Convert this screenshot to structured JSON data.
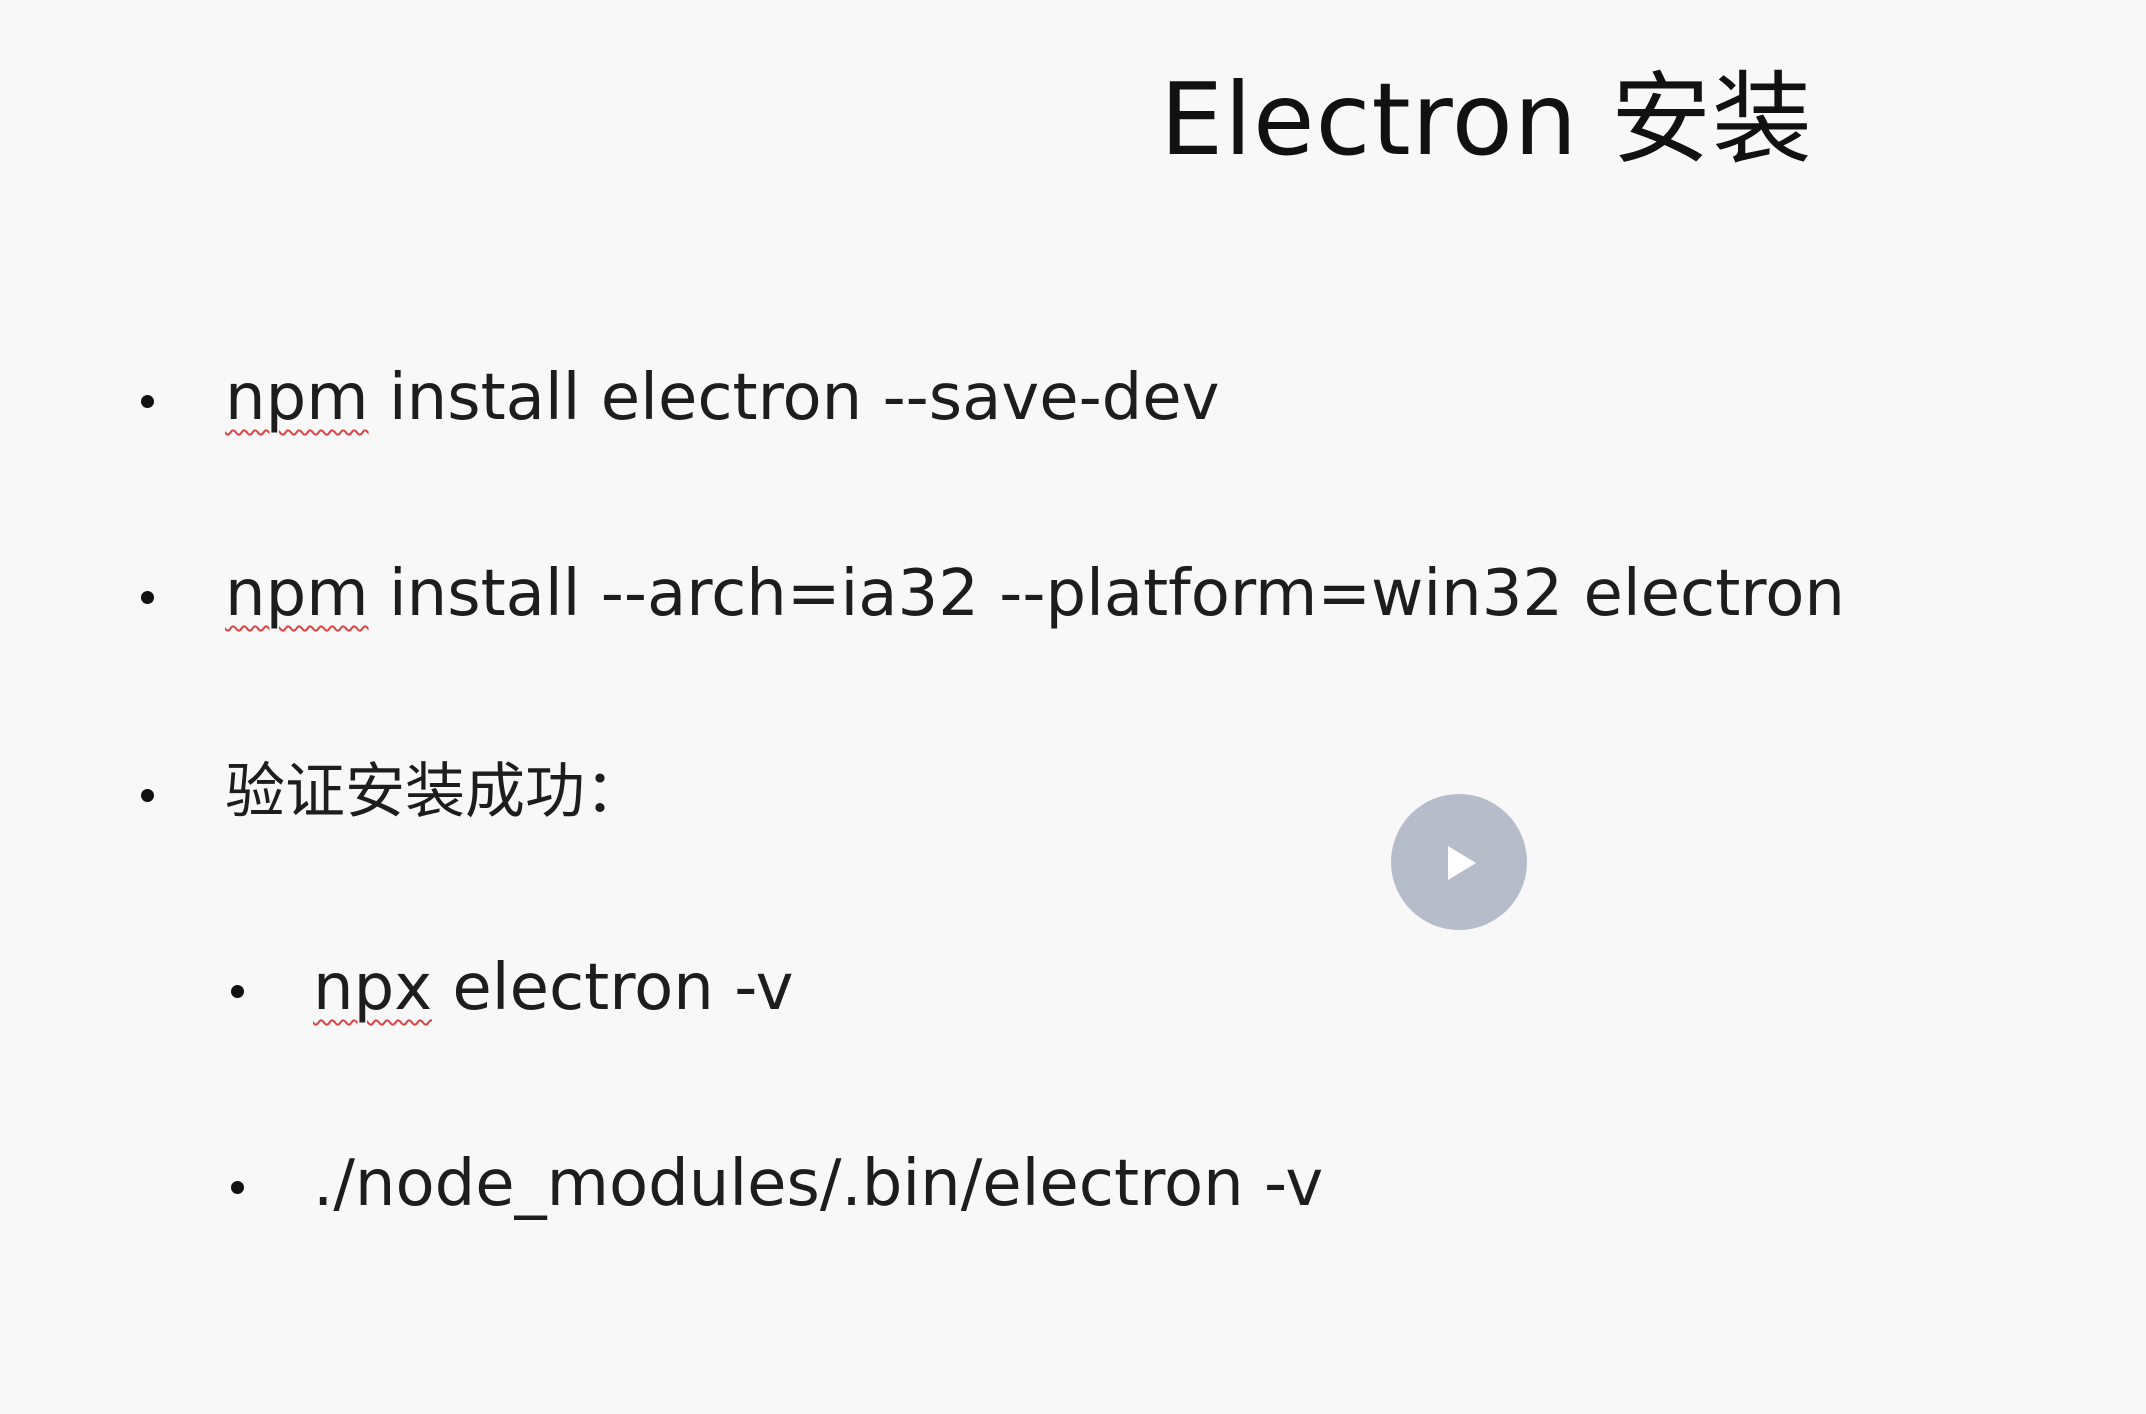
{
  "slide": {
    "title": "Electron 安装",
    "bullets": [
      {
        "lead": "npm",
        "rest": " install electron --save-dev"
      },
      {
        "lead": "npm",
        "rest": " install --arch=ia32 --platform=win32 electron"
      },
      {
        "lead": "",
        "rest": "验证安装成功："
      }
    ],
    "sub_bullets": [
      {
        "lead": "npx",
        "rest": " electron -v"
      },
      {
        "lead": "",
        "rest": "./node_modules/.bin/electron -v"
      }
    ]
  },
  "player": {
    "play_icon": "play-icon",
    "overlay_color": "#b7bccb"
  }
}
